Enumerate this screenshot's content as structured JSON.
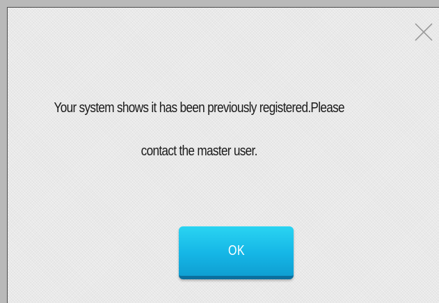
{
  "dialog": {
    "message_line1": "Your system shows it has been previously registered.Please",
    "message_line2": "contact the master user.",
    "ok_label": "OK",
    "close_icon": "close-icon"
  },
  "colors": {
    "button": "#15b6e6",
    "button_shadow": "#0b6f9e",
    "text": "#1a1a1a",
    "background": "#e9e9e9"
  }
}
